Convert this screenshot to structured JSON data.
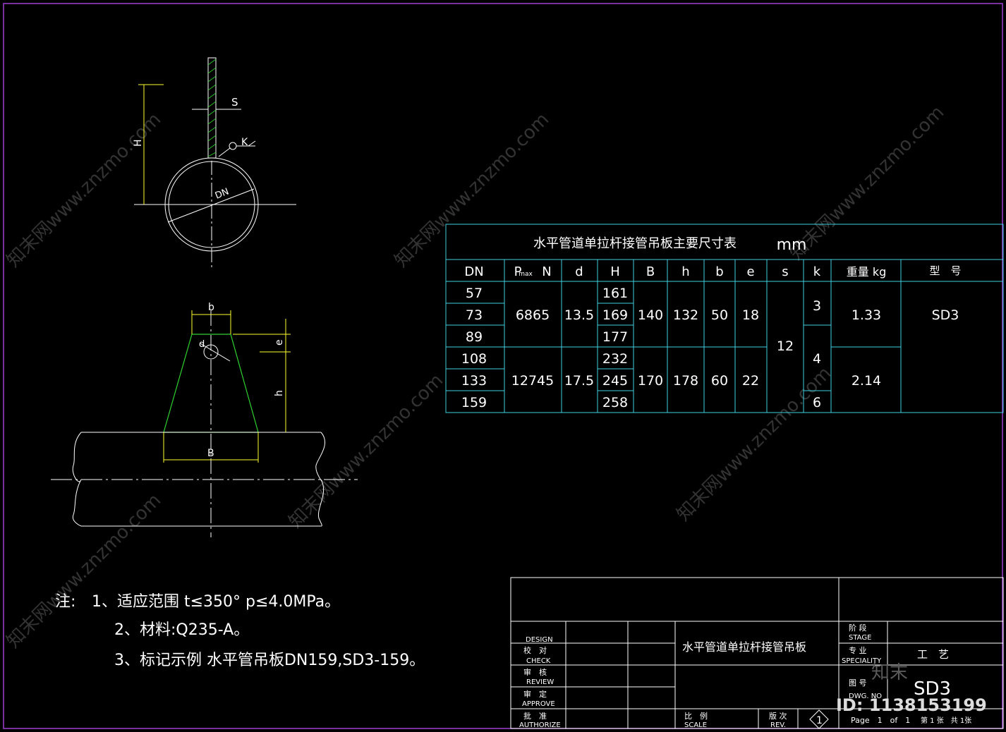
{
  "drawing": {
    "labels": {
      "S": "S",
      "K": "K",
      "H": "H",
      "DN": "DN",
      "b": "b",
      "d": "d",
      "e": "e",
      "h": "h",
      "B": "B"
    }
  },
  "table": {
    "title": "水平管道单拉杆接管吊板主要尺寸表",
    "unit": "mm",
    "headers": [
      "DN",
      "N",
      "d",
      "H",
      "B",
      "h",
      "b",
      "e",
      "s",
      "k",
      "重量 kg",
      "型　号"
    ],
    "p_sub": "max",
    "dn": [
      "57",
      "73",
      "89",
      "108",
      "133",
      "159"
    ],
    "H": [
      "161",
      "169",
      "177",
      "232",
      "245",
      "258"
    ],
    "group1": {
      "P": "6865",
      "d": "13.5",
      "B": "140",
      "h": "132",
      "b": "50",
      "e": "18",
      "k": "3",
      "weight": "1.33"
    },
    "group2": {
      "P": "12745",
      "d": "17.5",
      "B": "170",
      "h": "178",
      "b": "60",
      "e": "22",
      "k1": "4",
      "k2": "6",
      "weight": "2.14"
    },
    "s": "12",
    "model": "SD3"
  },
  "notes": {
    "prefix": "注:",
    "line1": "1、适应范围 t≤350° p≤4.0MPa。",
    "line2": "2、材料:Q235-A。",
    "line3": "3、标记示例 水平管吊板DN159,SD3-159。"
  },
  "titleblock": {
    "design": "DESIGN",
    "check_cn": "校　对",
    "check": "CHECK",
    "review_cn": "审　核",
    "review": "REVIEW",
    "approve_cn": "审　定",
    "approve": "APPROVE",
    "authorize_cn": "批　准",
    "authorize": "AUTHORIZE",
    "drawing_title": "水平管道单拉杆接管吊板",
    "scale_cn": "比　例",
    "scale": "SCALE",
    "rev_cn": "版 次",
    "rev": "REV.",
    "rev_no": "1",
    "stage_cn": "阶 段",
    "stage": "STAGE",
    "special_cn": "专 业",
    "special": "SPECIALITY",
    "special_val": "工　艺",
    "dwg_cn": "图 号",
    "dwg": "DWG. NO",
    "dwg_val": "SD3",
    "page": "Page　1　of　1",
    "sheet": "第 1 张　共 1张"
  },
  "watermark": {
    "site": "知末网www.znzmo.com",
    "logo": "知末",
    "id": "ID: 1138153199"
  },
  "colors": {
    "background": "#000000",
    "border": "#a040d0",
    "table_lines": "#40d0e0",
    "lines": "#ffffff",
    "plate": "#30d030",
    "dimension": "#ffff30"
  }
}
